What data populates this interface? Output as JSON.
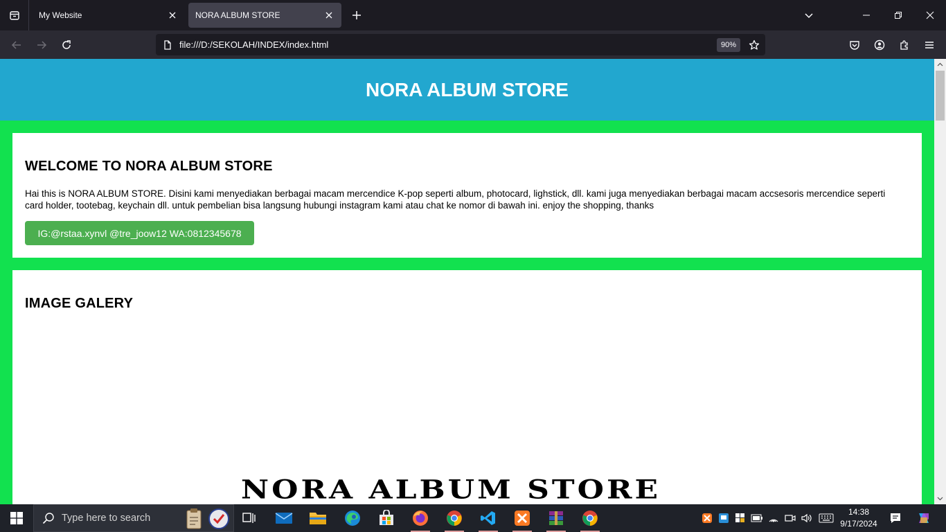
{
  "browser": {
    "tabs": [
      {
        "label": "My Website",
        "active": false
      },
      {
        "label": "NORA ALBUM STORE",
        "active": true
      }
    ],
    "url": "file:///D:/SEKOLAH/INDEX/index.html",
    "zoom": "90%"
  },
  "page": {
    "header_title": "NORA ALBUM STORE",
    "welcome": {
      "heading": "WELCOME TO NORA ALBUM STORE",
      "text": "Hai this is NORA ALBUM STORE. Disini kami menyediakan berbagai macam mercendice K-pop seperti album, photocard, lighstick, dll. kami juga menyediakan berbagai macam accsesoris mercendice seperti card holder, tootebag, keychain dll. untuk pembelian bisa langsung hubungi instagram kami atau chat ke nomor di bawah ini. enjoy the shopping, thanks",
      "contact_button": "IG:@rstaa.xynvl @tre_joow12 WA:0812345678"
    },
    "gallery": {
      "heading": "IMAGE GALERY",
      "logo_text": "NORA ALBUM STORE"
    }
  },
  "taskbar": {
    "search_placeholder": "Type here to search",
    "time": "14:38",
    "date": "9/17/2024"
  },
  "colors": {
    "header_bg": "#22a7cf",
    "page_bg": "#12e14f",
    "button_bg": "#4caf50"
  }
}
